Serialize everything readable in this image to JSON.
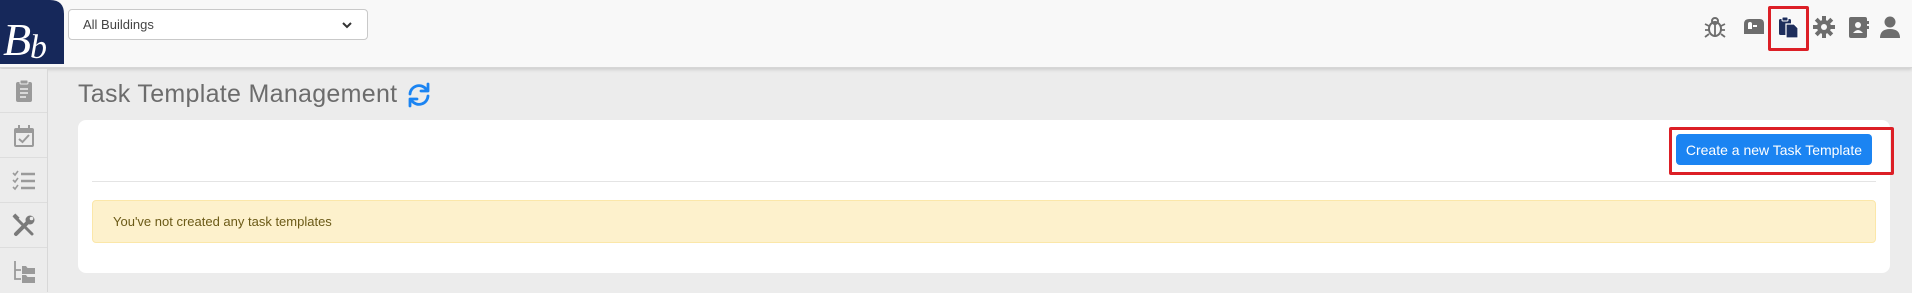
{
  "header": {
    "logo_text": "Bb",
    "building_select": {
      "selected": "All Buildings"
    },
    "icons": [
      "bug-icon",
      "mailbox-icon",
      "clipboard-copy-icon",
      "gear-icon",
      "contact-card-icon",
      "user-icon"
    ]
  },
  "sidebar": {
    "items": [
      {
        "icon": "clipboard-list-icon"
      },
      {
        "icon": "calendar-check-icon"
      },
      {
        "icon": "checklist-icon"
      },
      {
        "icon": "tools-icon"
      },
      {
        "icon": "folder-tree-icon"
      }
    ]
  },
  "main": {
    "title": "Task Template Management",
    "create_button_label": "Create a new Task Template",
    "empty_message": "You've not created any task templates"
  },
  "colors": {
    "accent": "#1b84f2",
    "highlight": "#dc1f26",
    "logo_navy": "#16285a",
    "alert_bg": "#fdf1cc"
  }
}
